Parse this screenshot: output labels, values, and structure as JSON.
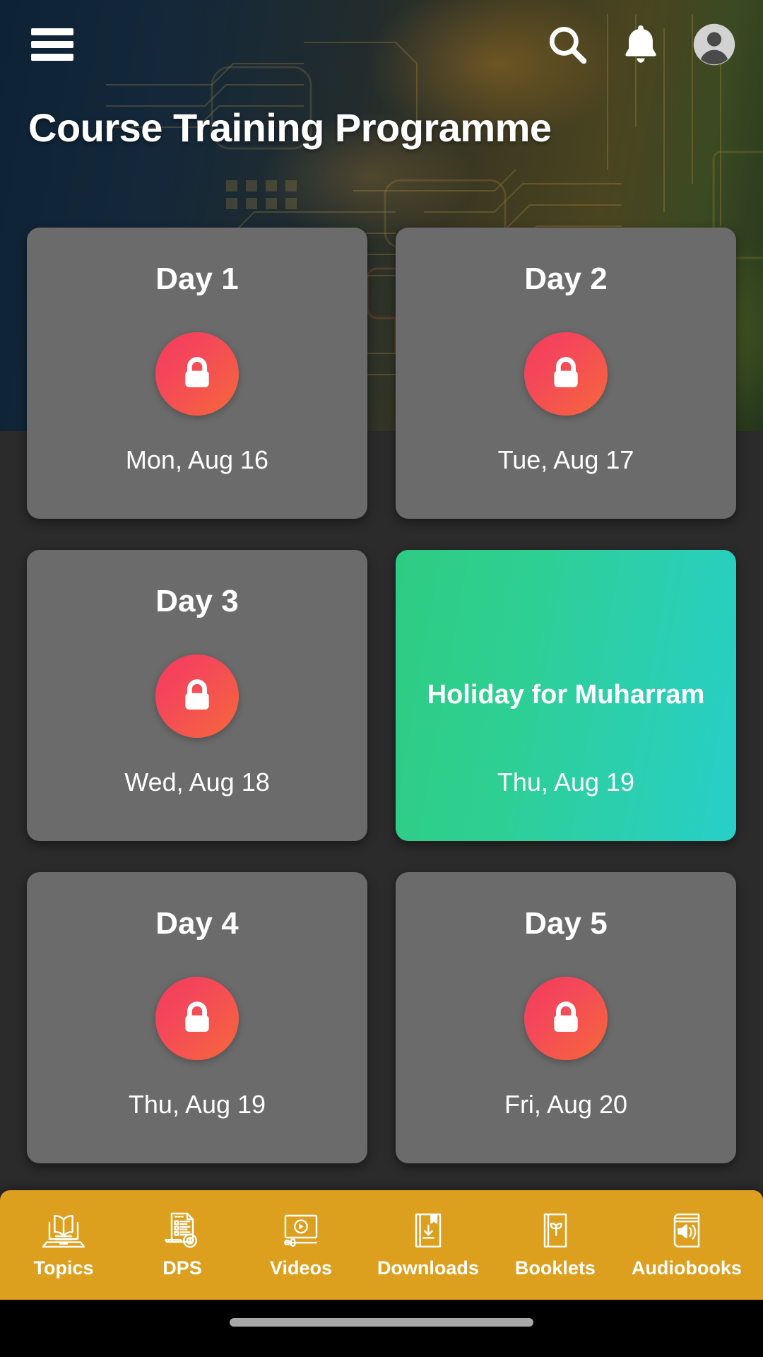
{
  "header": {
    "title": "Course Training Programme",
    "menu_icon": "hamburger-menu-icon",
    "icons": [
      {
        "name": "search-icon",
        "label": "Search"
      },
      {
        "name": "notification-bell-icon",
        "label": "Notifications"
      },
      {
        "name": "user-avatar-icon",
        "label": "Profile"
      }
    ],
    "gradient_start": "#0e2236",
    "gradient_end": "#24351c"
  },
  "cards": [
    {
      "title": "Day 1",
      "date": "Mon, Aug 16",
      "locked": true,
      "type": "day"
    },
    {
      "title": "Day 2",
      "date": "Tue, Aug 17",
      "locked": true,
      "type": "day"
    },
    {
      "title": "Day 3",
      "date": "Wed, Aug 18",
      "locked": true,
      "type": "day"
    },
    {
      "title": "Holiday for Muharram",
      "date": "Thu, Aug 19",
      "locked": false,
      "type": "holiday"
    },
    {
      "title": "Day 4",
      "date": "Thu, Aug 19",
      "locked": true,
      "type": "day"
    },
    {
      "title": "Day 5",
      "date": "Fri, Aug 20",
      "locked": true,
      "type": "day"
    }
  ],
  "colors": {
    "page_background": "#2b2b2b",
    "card_background": "#6b6b6b",
    "lock_gradient_start": "#f43b5c",
    "lock_gradient_end": "#f56a3c",
    "holiday_gradient_start": "#2ecc82",
    "holiday_gradient_end": "#27cfc9",
    "bottom_nav": "#dda01e",
    "text_on_card": "#ffffff"
  },
  "bottom_nav": {
    "items": [
      {
        "label": "Topics",
        "icon": "book-on-laptop-icon"
      },
      {
        "label": "DPS",
        "icon": "document-with-seal-icon"
      },
      {
        "label": "Videos",
        "icon": "video-player-icon"
      },
      {
        "label": "Downloads",
        "icon": "book-download-icon"
      },
      {
        "label": "Booklets",
        "icon": "book-sprout-icon"
      },
      {
        "label": "Audiobooks",
        "icon": "audiobook-speaker-icon"
      }
    ]
  },
  "system": {
    "home_indicator": "home-indicator-bar"
  }
}
